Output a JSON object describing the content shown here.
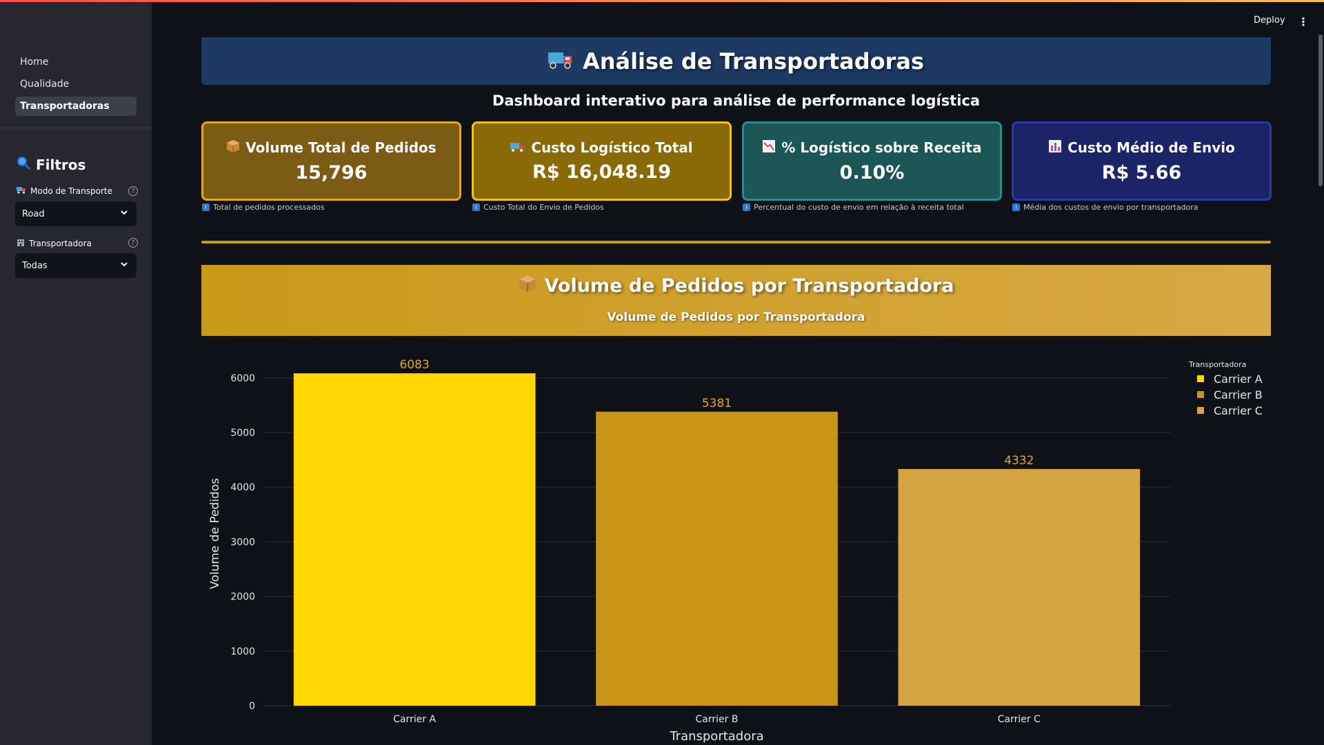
{
  "app": {
    "deploy_label": "Deploy",
    "menu_label": "⋮"
  },
  "sidebar": {
    "nav": [
      {
        "label": "Home"
      },
      {
        "label": "Qualidade"
      },
      {
        "label": "Transportadoras"
      }
    ],
    "filters_title": "Filtros",
    "filters": [
      {
        "label": "Modo de Transporte",
        "value": "Road"
      },
      {
        "label": "Transportadora",
        "value": "Todas"
      }
    ]
  },
  "header": {
    "title": "Análise de Transportadoras",
    "subtitle": "Dashboard interativo para análise de performance logística"
  },
  "metrics": [
    {
      "title": "Volume Total de Pedidos",
      "value": "15,796",
      "caption": "Total de pedidos processados",
      "icon": "package-icon",
      "bg": "#7c5c14",
      "border": "#e0a825"
    },
    {
      "title": "Custo Logístico Total",
      "value": "R$ 16,048.19",
      "caption": "Custo Total do Envio de Pedidos",
      "icon": "truck-icon",
      "bg": "#8a6a06",
      "border": "#f0c21c"
    },
    {
      "title": "% Logístico sobre Receita",
      "value": "0.10%",
      "caption": "Percentual do custo de envio em relação à receita total",
      "icon": "chart-down-icon",
      "bg": "#1d5656",
      "border": "#2a8f8a"
    },
    {
      "title": "Custo Médio de Envio",
      "value": "R$ 5.66",
      "caption": "Média dos custos de envio por transportadora",
      "icon": "bar-chart-icon",
      "bg": "#1a2466",
      "border": "#2b3aa6"
    }
  ],
  "section": {
    "title": "Volume de Pedidos por Transportadora",
    "subtitle": "Volume de Pedidos por Transportadora"
  },
  "chart_data": {
    "type": "bar",
    "categories": [
      "Carrier A",
      "Carrier B",
      "Carrier C"
    ],
    "values": [
      6083,
      5381,
      4332
    ],
    "colors": [
      "#ffd700",
      "#c99514",
      "#d4a443"
    ],
    "xlabel": "Transportadora",
    "ylabel": "Volume de Pedidos",
    "ylim": [
      0,
      6300
    ],
    "yticks": [
      0,
      1000,
      2000,
      3000,
      4000,
      5000,
      6000
    ],
    "legend_title": "Transportadora",
    "legend_position": "top-right",
    "grid": true
  }
}
